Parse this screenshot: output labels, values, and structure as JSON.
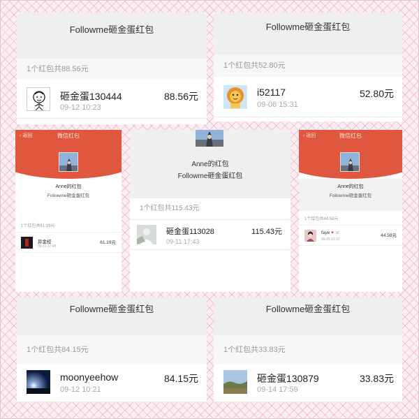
{
  "panels": {
    "top_left": {
      "title": "Followme砸金蛋红包",
      "summary": "1个红包共88.56元",
      "recipient": {
        "name": "砸金蛋130444",
        "time": "09-12 10:23",
        "amount": "88.56元",
        "avatar_icon": "doodle-face-icon"
      }
    },
    "top_right": {
      "title": "Followme砸金蛋红包",
      "summary": "1个红包共52.80元",
      "recipient": {
        "name": "i52117",
        "time": "09-06 15:31",
        "amount": "52.80元",
        "avatar_icon": "cartoon-lion-icon"
      }
    },
    "middle_center": {
      "sender": "Anne的红包",
      "title": "Followme砸金蛋红包",
      "summary": "1个红包共115.43元",
      "recipient": {
        "name": "砸金蛋113028",
        "time": "09-11 17:43",
        "amount": "115.43元",
        "avatar_icon": "photo-avatar-icon"
      }
    },
    "bottom_left": {
      "title": "Followme砸金蛋红包",
      "summary": "1个红包共84.15元",
      "recipient": {
        "name": "moonyeehow",
        "time": "09-12 10:21",
        "amount": "84.15元",
        "avatar_icon": "night-sky-icon"
      }
    },
    "bottom_right": {
      "title": "Followme砸金蛋红包",
      "summary": "1个红包共33.83元",
      "recipient": {
        "name": "砸金蛋130879",
        "time": "09-14 17:59",
        "amount": "33.83元",
        "avatar_icon": "landscape-icon"
      }
    }
  },
  "phones": {
    "left": {
      "back_label": "返回",
      "nav_title": "微信红包",
      "sender": "Anne的红包",
      "wish": "Followme砸金蛋红包",
      "summary": "1个红包共61.19元",
      "recipient": {
        "name": "异金经",
        "time": "09-11 17:48",
        "amount": "61.19元",
        "avatar_icon": "dark-photo-icon"
      }
    },
    "right": {
      "back_label": "返回",
      "nav_title": "微信红包",
      "sender": "Anne的红包",
      "wish": "Followme砸金蛋红包",
      "summary": "1个红包共44.58元",
      "recipient": {
        "name": "faye",
        "time": "09-06 15:37",
        "amount": "44.58元",
        "avatar_icon": "portrait-icon"
      }
    }
  },
  "colors": {
    "wechat_red": "#e0573f",
    "header_gray": "#efefef",
    "background_pink": "#fbeef2"
  }
}
